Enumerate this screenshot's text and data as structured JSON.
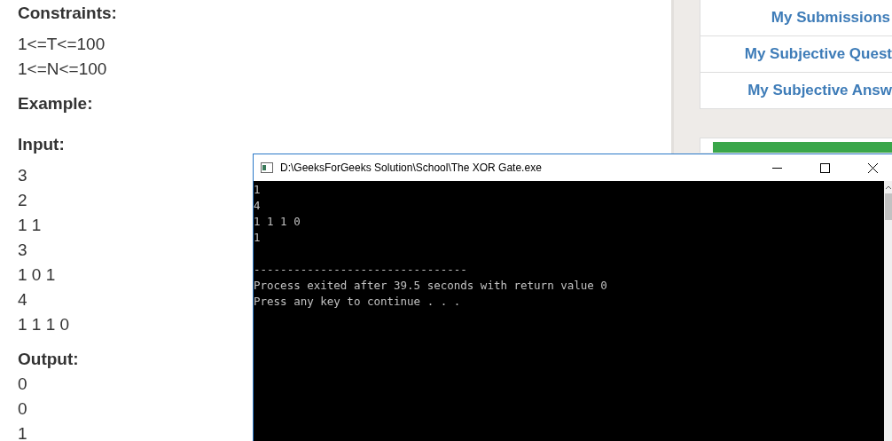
{
  "problem": {
    "sections": [
      {
        "heading": "Constraints:",
        "lines": [
          "1<=T<=100",
          "1<=N<=100"
        ]
      },
      {
        "heading": "Example:"
      },
      {
        "heading": "Input:",
        "lines": [
          "3",
          "2",
          "1 1",
          "3",
          "1 0 1",
          "4",
          "1 1 1 0"
        ]
      },
      {
        "heading": "Output:",
        "lines": [
          "0",
          "0",
          "1"
        ]
      }
    ]
  },
  "sidebar": {
    "links": [
      "My Submissions",
      "My Subjective Quest",
      "My Subjective Answ"
    ]
  },
  "console": {
    "title": "D:\\GeeksForGeeks Solution\\School\\The XOR Gate.exe",
    "output": [
      "1",
      "4",
      "1 1 1 0",
      "1"
    ],
    "footer": [
      "--------------------------------",
      "Process exited after 39.5 seconds with return value 0",
      "Press any key to continue . . ."
    ]
  }
}
